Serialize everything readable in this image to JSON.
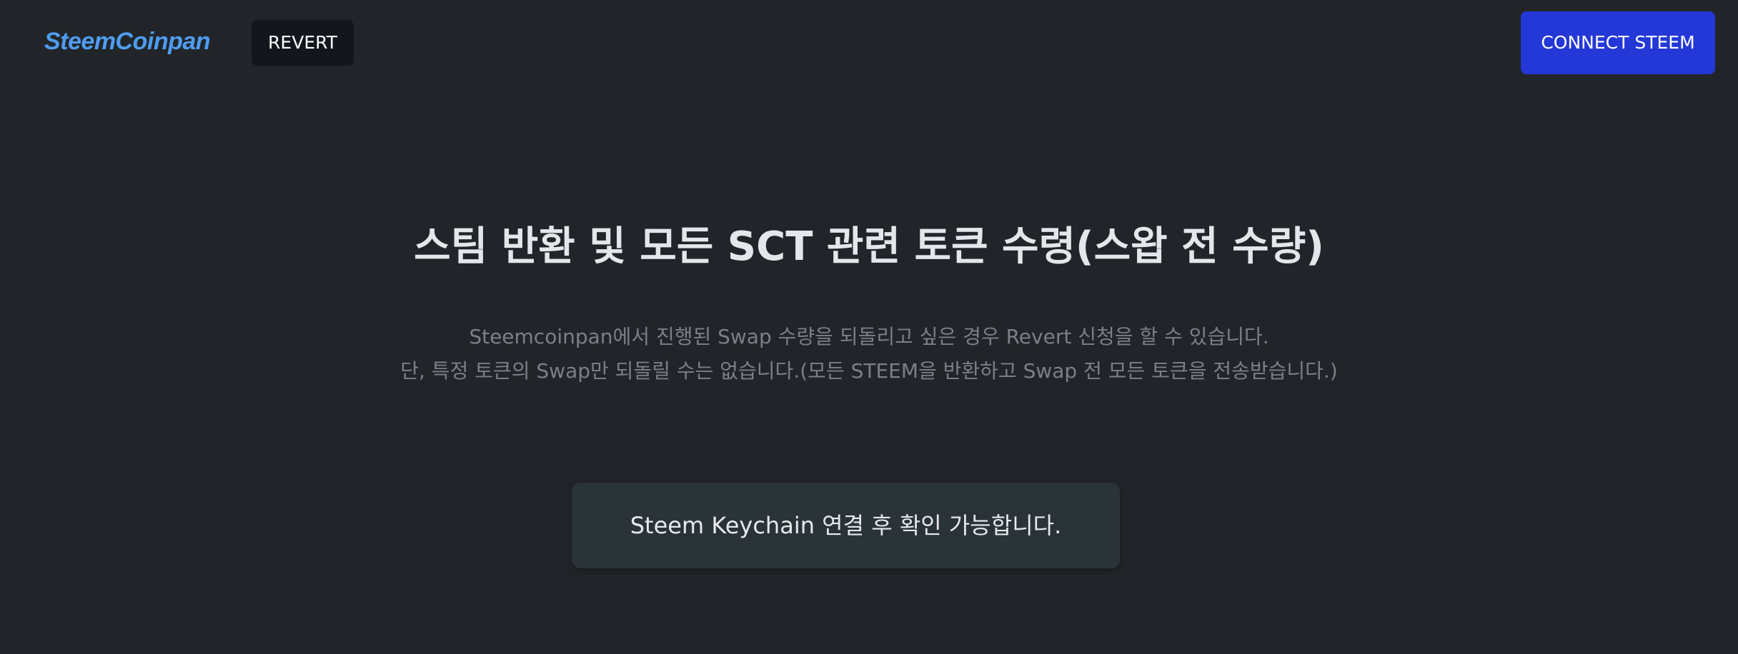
{
  "header": {
    "logo_text": "SteemCoinpan",
    "nav_revert_label": "REVERT",
    "connect_label": "CONNECT STEEM"
  },
  "colors": {
    "background": "#212529",
    "logo": "#4f9cf0",
    "nav_button_bg": "#13161c",
    "connect_button_bg": "#2338d6",
    "notice_bg": "#2a3338"
  },
  "main": {
    "title": "스팀 반환 및 모든 SCT 관련 토큰 수령(스왑 전 수량)",
    "description_line1": "Steemcoinpan에서 진행된 Swap 수량을 되돌리고 싶은 경우 Revert 신청을 할 수 있습니다.",
    "description_line2": "단, 특정 토큰의 Swap만 되돌릴 수는 없습니다.(모든 STEEM을 반환하고 Swap 전 모든 토큰을 전송받습니다.)",
    "notice_text": "Steem Keychain 연결 후 확인 가능합니다."
  }
}
